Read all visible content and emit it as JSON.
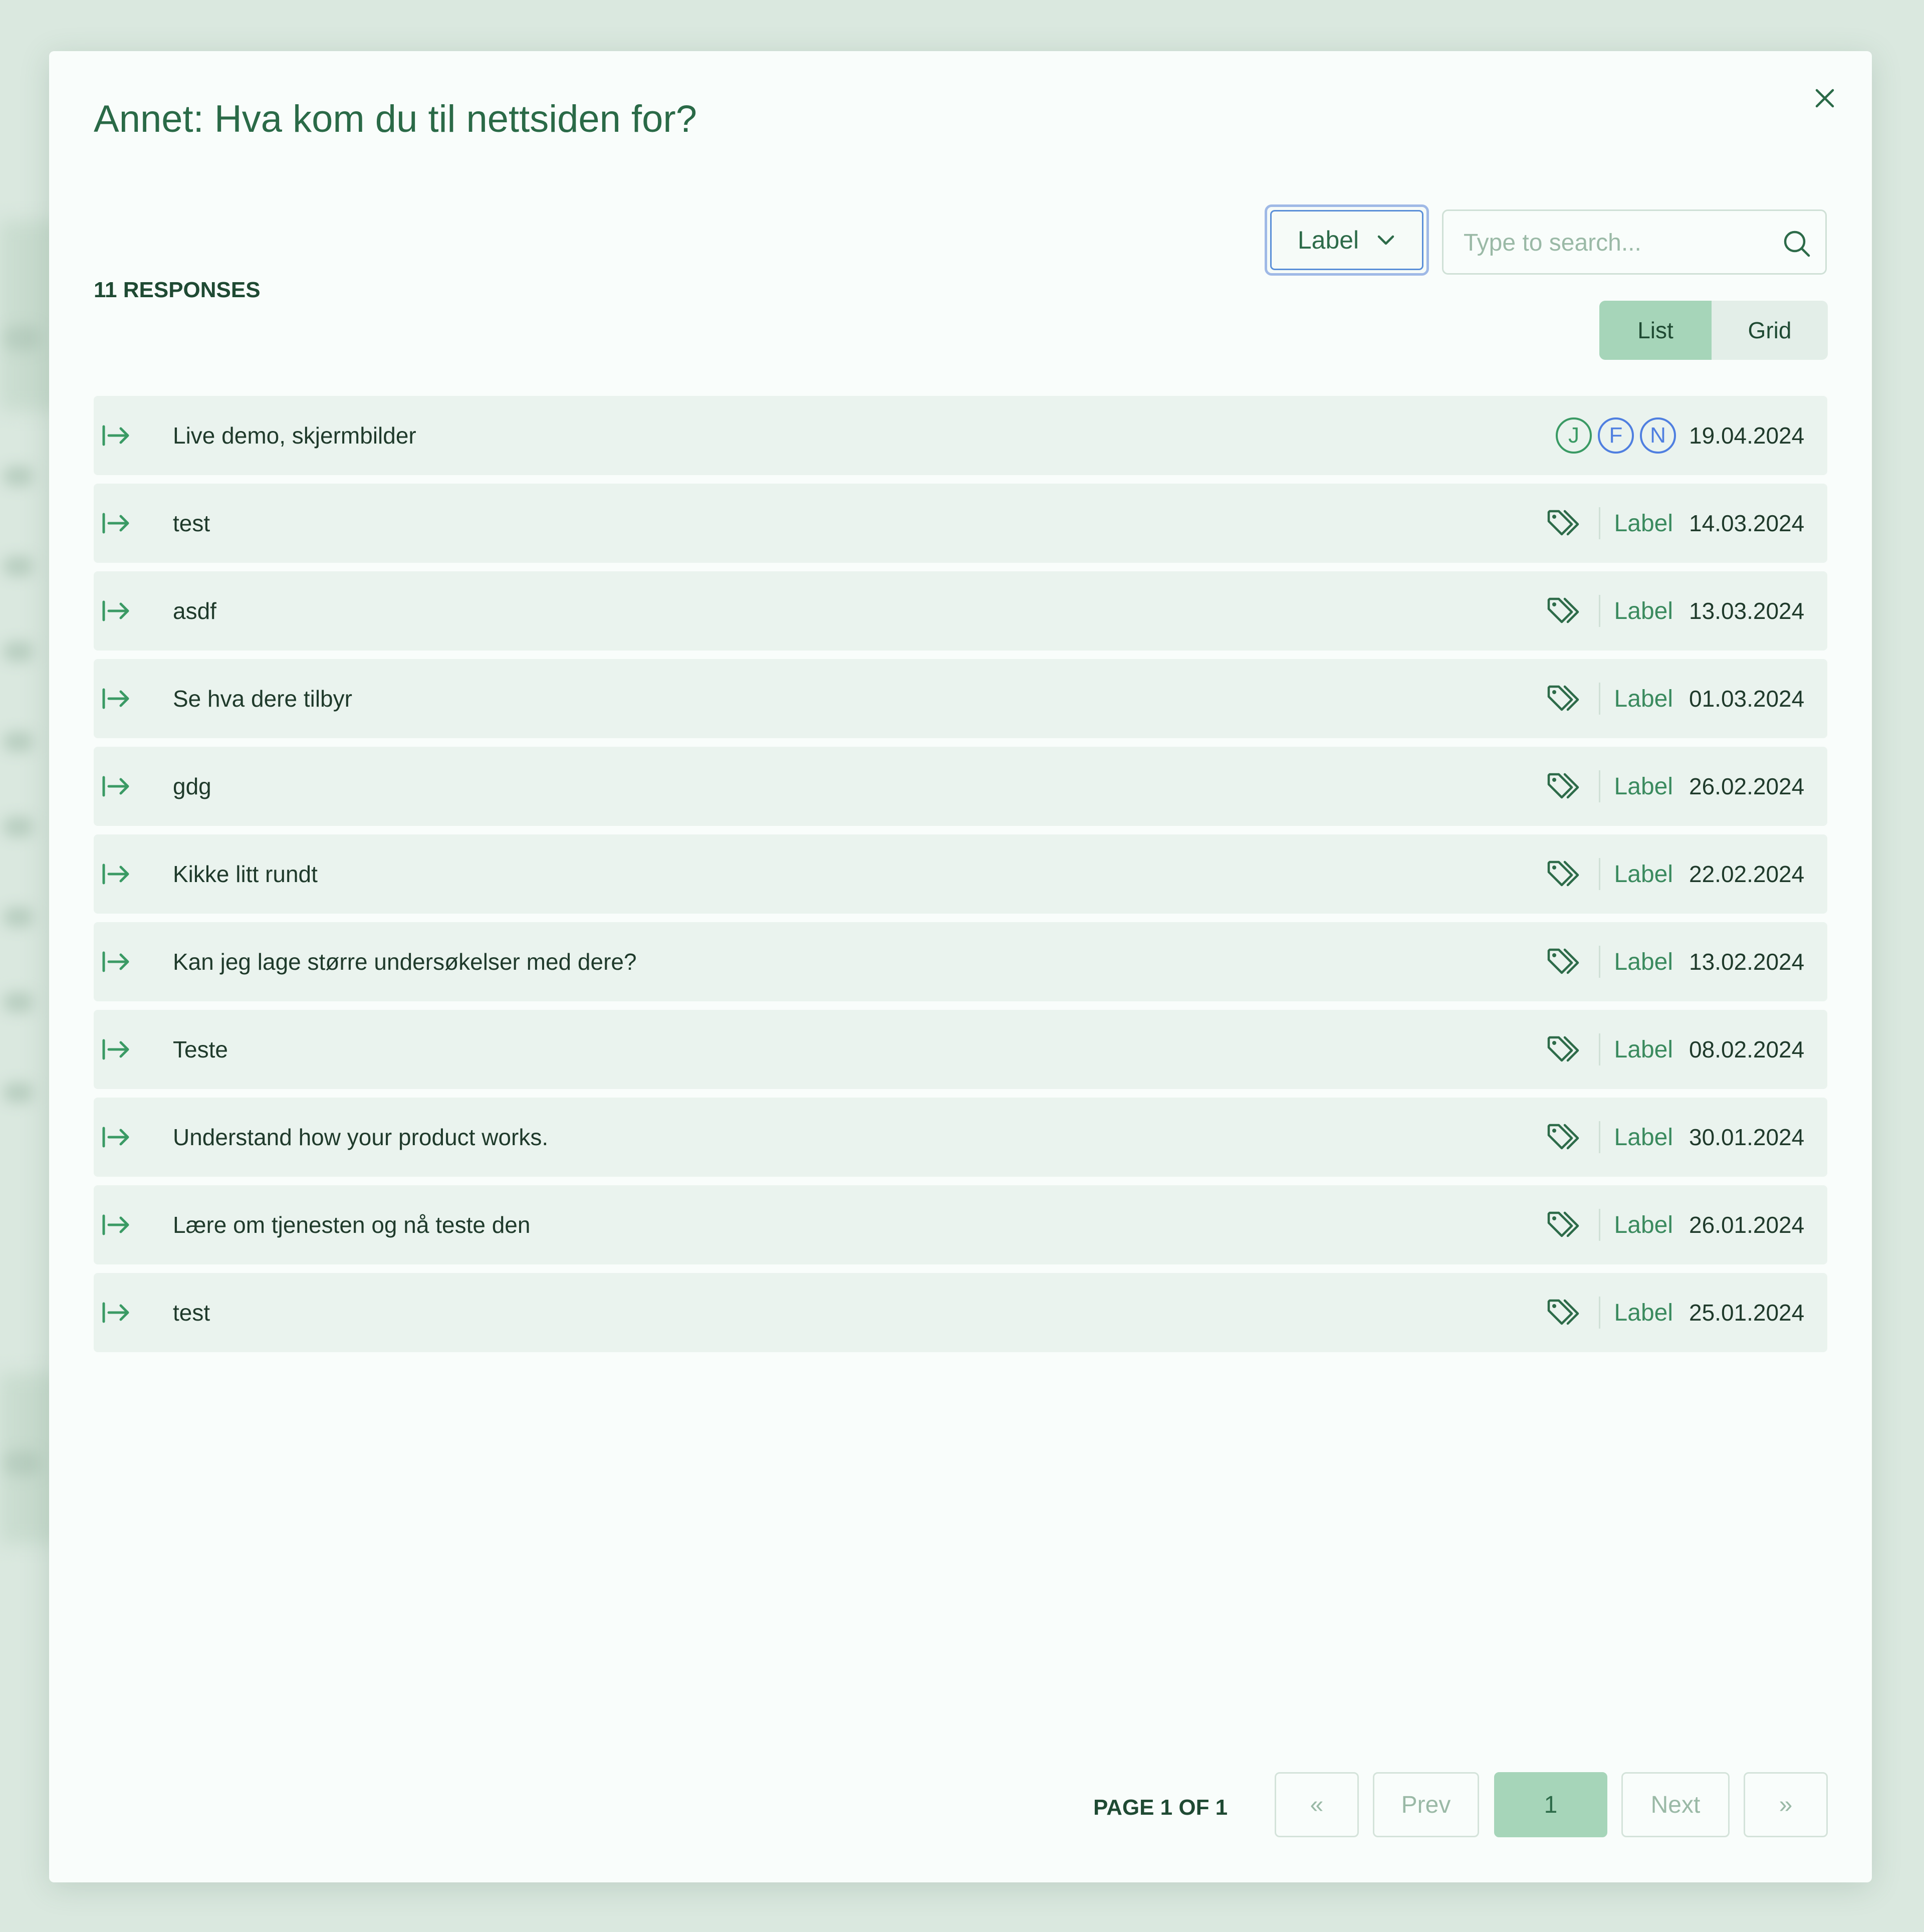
{
  "modal": {
    "title": "Annet: Hva kom du til nettsiden for?",
    "response_count": "11 RESPONSES",
    "filter_dropdown": {
      "selected": "Label"
    },
    "search": {
      "placeholder": "Type to search..."
    },
    "view_toggle": {
      "list": "List",
      "grid": "Grid",
      "active": "List"
    },
    "responses": [
      {
        "text": "Live demo, skjermbilder",
        "date": "19.04.2024",
        "avatars": [
          {
            "initial": "J",
            "color": "#3a9a64"
          },
          {
            "initial": "F",
            "color": "#4f7fe0"
          },
          {
            "initial": "N",
            "color": "#4f7fe0"
          }
        ]
      },
      {
        "text": "test",
        "label": "Label",
        "date": "14.03.2024"
      },
      {
        "text": "asdf",
        "label": "Label",
        "date": "13.03.2024"
      },
      {
        "text": "Se hva dere tilbyr",
        "label": "Label",
        "date": "01.03.2024"
      },
      {
        "text": "gdg",
        "label": "Label",
        "date": "26.02.2024"
      },
      {
        "text": "Kikke litt rundt",
        "label": "Label",
        "date": "22.02.2024"
      },
      {
        "text": "Kan jeg lage større undersøkelser med dere?",
        "label": "Label",
        "date": "13.02.2024"
      },
      {
        "text": "Teste",
        "label": "Label",
        "date": "08.02.2024"
      },
      {
        "text": "Understand how your product works.",
        "label": "Label",
        "date": "30.01.2024"
      },
      {
        "text": "Lære om tjenesten og nå teste den",
        "label": "Label",
        "date": "26.01.2024"
      },
      {
        "text": "test",
        "label": "Label",
        "date": "25.01.2024"
      }
    ],
    "pagination": {
      "info": "PAGE 1 OF 1",
      "first": "«",
      "prev": "Prev",
      "current": "1",
      "next": "Next",
      "last": "»"
    }
  },
  "colors": {
    "accent": "#3a8a5e",
    "active_toggle": "#a6d5b9",
    "row_background": "#eaf3ee"
  }
}
